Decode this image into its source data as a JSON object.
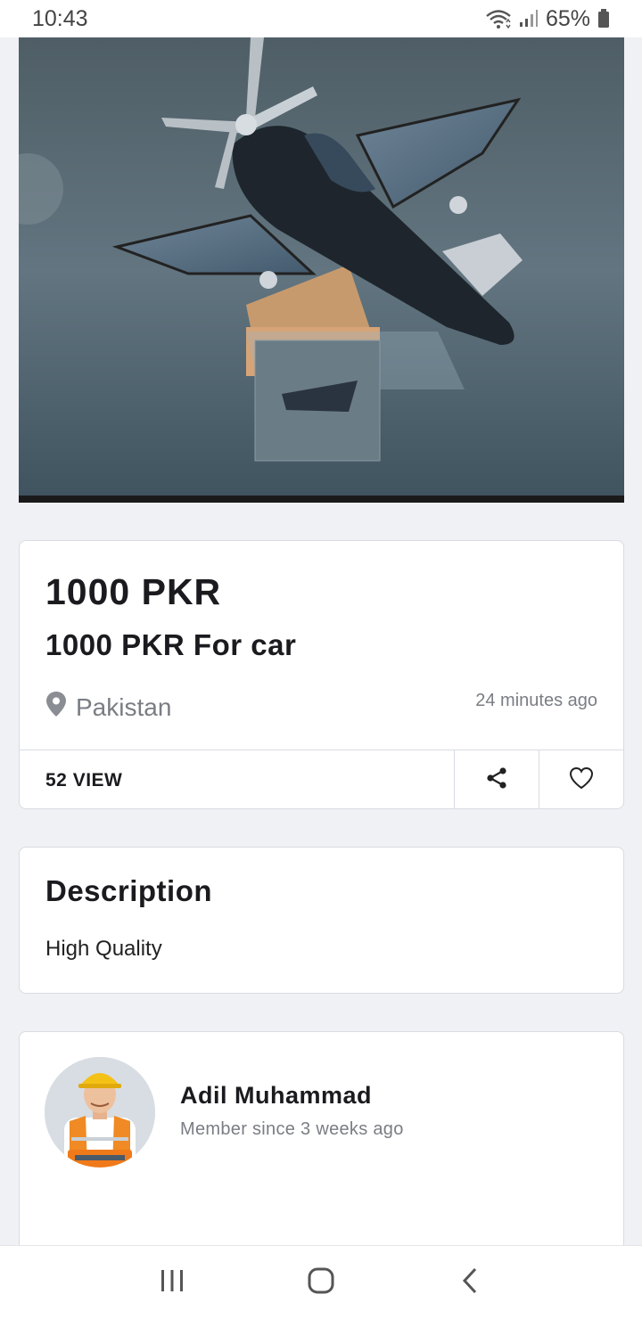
{
  "status_bar": {
    "time": "10:43",
    "battery": "65%",
    "icons": [
      "wifi-icon",
      "signal-icon",
      "battery-icon"
    ]
  },
  "product_image": {
    "icon": "product-photo-airplane-car-ornament"
  },
  "listing": {
    "price": "1000 PKR",
    "title": "1000 PKR For car",
    "location": "Pakistan",
    "posted": "24 minutes ago",
    "views": "52 VIEW",
    "icons": {
      "location": "location-pin-icon",
      "share": "share-icon",
      "favorite": "heart-icon"
    }
  },
  "description": {
    "heading": "Description",
    "text": "High Quality"
  },
  "seller": {
    "name": "Adil Muhammad",
    "member_since": "Member since 3 weeks ago"
  },
  "navigation": {
    "icons": [
      "recent-apps-icon",
      "home-icon",
      "back-icon"
    ]
  },
  "colors": {
    "background": "#f0f1f5",
    "card": "#ffffff",
    "border": "#d8dbe2",
    "text_primary": "#1b1b1f",
    "text_secondary": "#7a7d84"
  }
}
